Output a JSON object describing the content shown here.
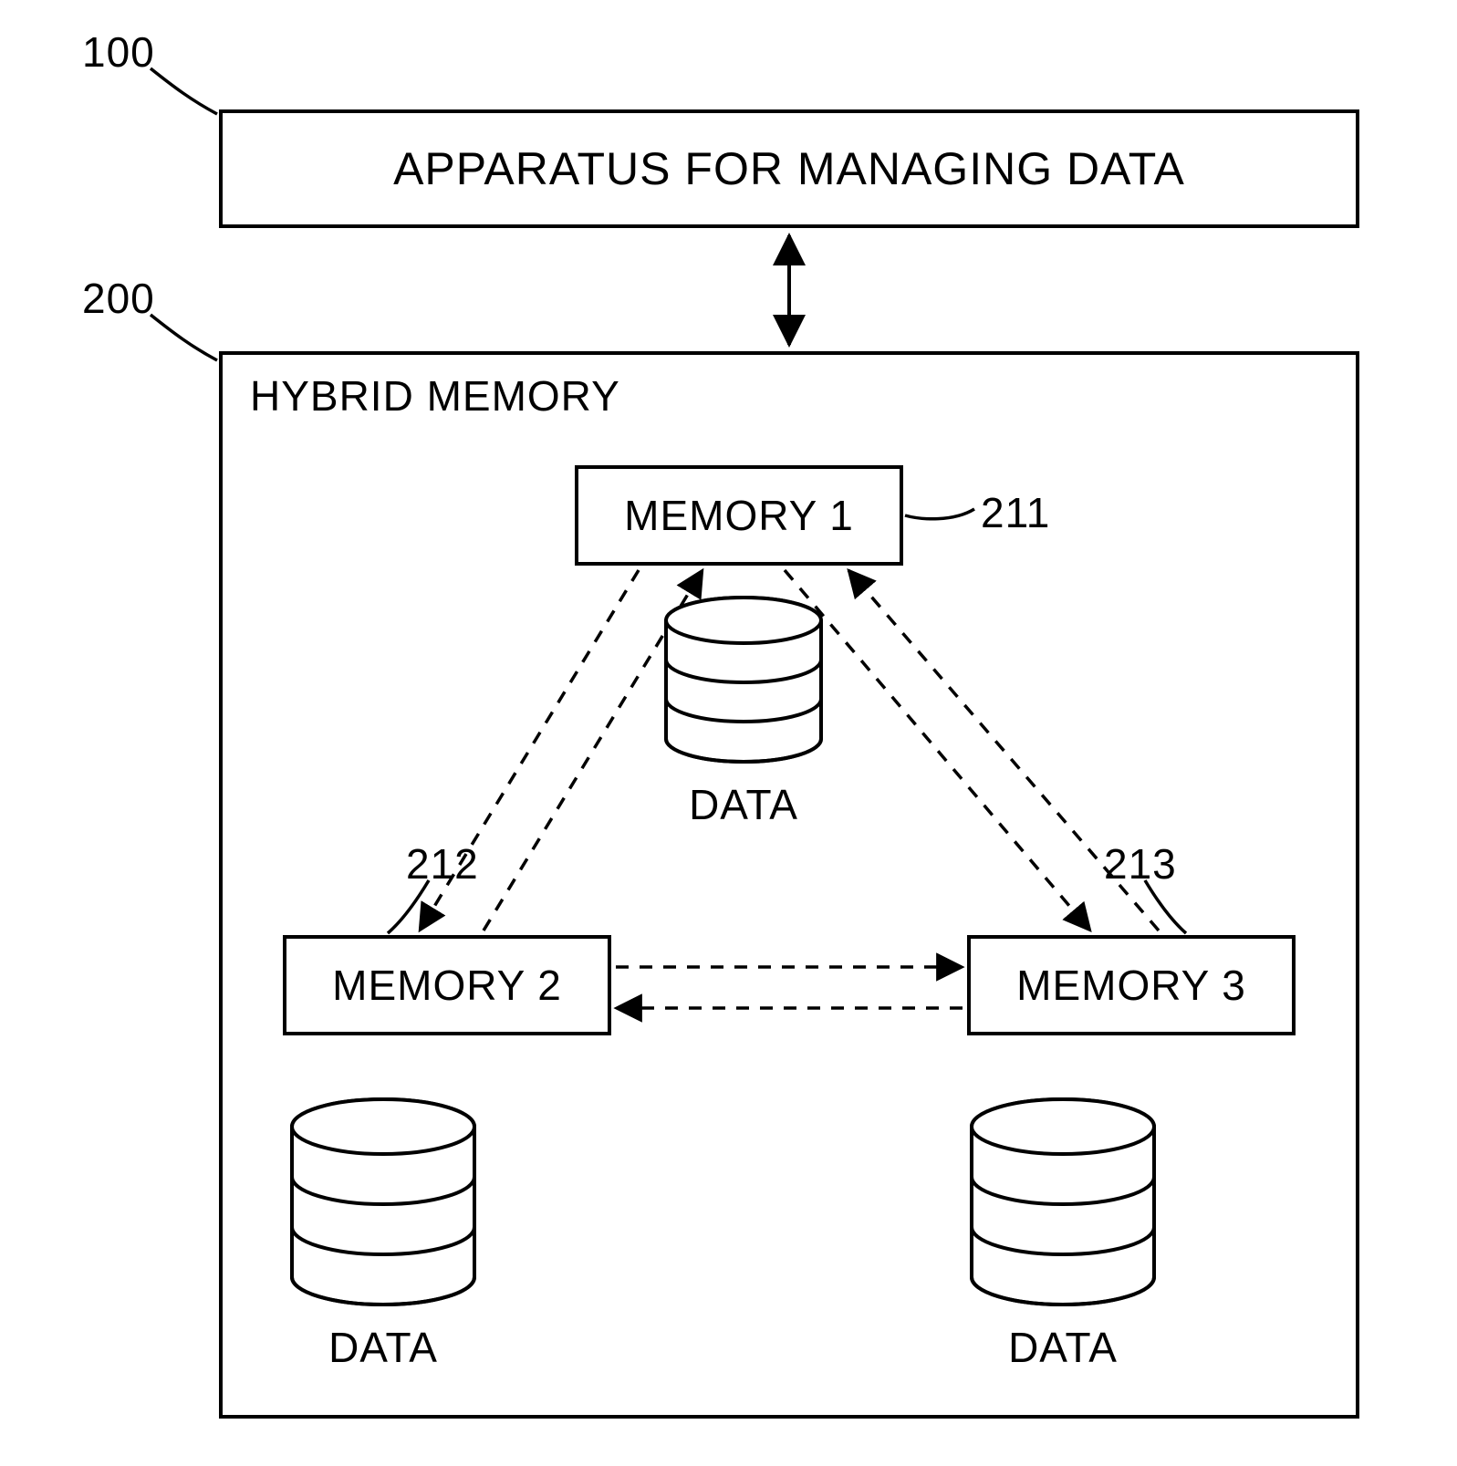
{
  "refs": {
    "apparatus": "100",
    "hybrid_memory": "200",
    "memory1": "211",
    "memory2": "212",
    "memory3": "213"
  },
  "top_box": {
    "label": "APPARATUS FOR MANAGING DATA"
  },
  "hybrid": {
    "title": "HYBRID MEMORY"
  },
  "nodes": {
    "memory1": {
      "label": "MEMORY 1",
      "data_label": "DATA"
    },
    "memory2": {
      "label": "MEMORY 2",
      "data_label": "DATA"
    },
    "memory3": {
      "label": "MEMORY 3",
      "data_label": "DATA"
    }
  },
  "connections": {
    "top_to_hybrid": "bidirectional-solid",
    "m1_m2": "bidirectional-dashed",
    "m1_m3": "bidirectional-dashed",
    "m2_m3": "bidirectional-dashed"
  }
}
